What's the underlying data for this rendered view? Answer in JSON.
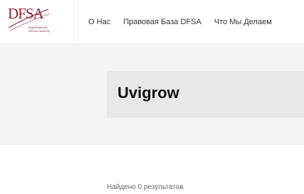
{
  "header": {
    "logo": {
      "wordmark": "DFSA",
      "subtitle": "Dubai Financial Services Authority"
    },
    "nav": [
      {
        "label": "О Нас"
      },
      {
        "label": "Правовая База DFSA"
      },
      {
        "label": "Что Мы Делаем"
      }
    ]
  },
  "banner": {
    "title": "Uvigrow"
  },
  "results": {
    "text": "Найдено 0 результатов"
  },
  "colors": {
    "brand": "#8a2331",
    "banner_bg": "#f4f4f5",
    "title_box_bg": "#e8e8ea"
  }
}
